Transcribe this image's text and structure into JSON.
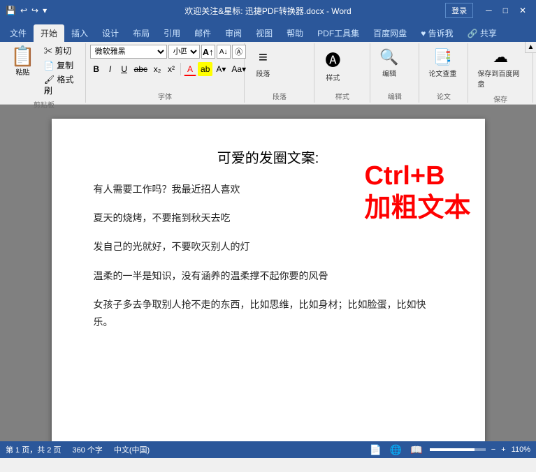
{
  "titlebar": {
    "title": "欢迎关注&星标: 迅捷PDF转换器.docx - Word",
    "login_label": "登录",
    "save_icon": "💾",
    "undo_icon": "↩",
    "redo_icon": "↪",
    "customize_icon": "▾"
  },
  "title_controls": {
    "minimize": "─",
    "restore": "□",
    "close": "✕"
  },
  "ribbon_tabs": [
    {
      "label": "文件",
      "active": false
    },
    {
      "label": "开始",
      "active": true
    },
    {
      "label": "插入",
      "active": false
    },
    {
      "label": "设计",
      "active": false
    },
    {
      "label": "布局",
      "active": false
    },
    {
      "label": "引用",
      "active": false
    },
    {
      "label": "邮件",
      "active": false
    },
    {
      "label": "审阅",
      "active": false
    },
    {
      "label": "视图",
      "active": false
    },
    {
      "label": "帮助",
      "active": false
    },
    {
      "label": "PDF工具集",
      "active": false
    },
    {
      "label": "百度网盘",
      "active": false
    },
    {
      "label": "♥ 告诉我",
      "active": false
    },
    {
      "label": "♿ 共享",
      "active": false
    }
  ],
  "ribbon": {
    "clipboard": {
      "paste_label": "粘贴",
      "cut_label": "剪切",
      "copy_label": "复制",
      "format_label": "格式刷",
      "section_label": "剪贴板"
    },
    "font": {
      "font_name": "微软雅黑",
      "font_size": "小四",
      "grow_label": "A",
      "shrink_label": "A",
      "clear_label": "Ⓐ",
      "bold_label": "B",
      "italic_label": "I",
      "underline_label": "U",
      "strikethrough_label": "abc",
      "subscript_label": "x₂",
      "superscript_label": "x²",
      "font_color_label": "A",
      "highlight_label": "ab",
      "section_label": "字体"
    },
    "paragraph": {
      "label": "段落",
      "btn_label": "段落"
    },
    "style": {
      "label": "样式",
      "btn_label": "样式"
    },
    "edit": {
      "label": "编辑",
      "btn_label": "编辑"
    },
    "thesis": {
      "label": "论文",
      "check_label": "论文查重",
      "save_label": "保存到百度网盘",
      "section_label": "论文",
      "save_section_label": "保存"
    }
  },
  "document": {
    "title": "可爱的发圈文案:",
    "lines": [
      "有人需要工作吗？我最近招人喜欢",
      "夏天的烧烤，不要拖到秋天去吃",
      "发自己的光就好，不要吹灭别人的灯",
      "温柔的一半是知识，没有涵养的温柔撑不起你要的风骨",
      "女孩子多去争取别人抢不走的东西，比如思维，比如身材；比如脸蛋，比如快乐。"
    ],
    "overlay_line1": "Ctrl+B",
    "overlay_line2": "加粗文本"
  },
  "statusbar": {
    "page_info": "第 1 页，共 2 页",
    "word_count": "360 个字",
    "language": "中文(中国)",
    "zoom": "110%"
  }
}
